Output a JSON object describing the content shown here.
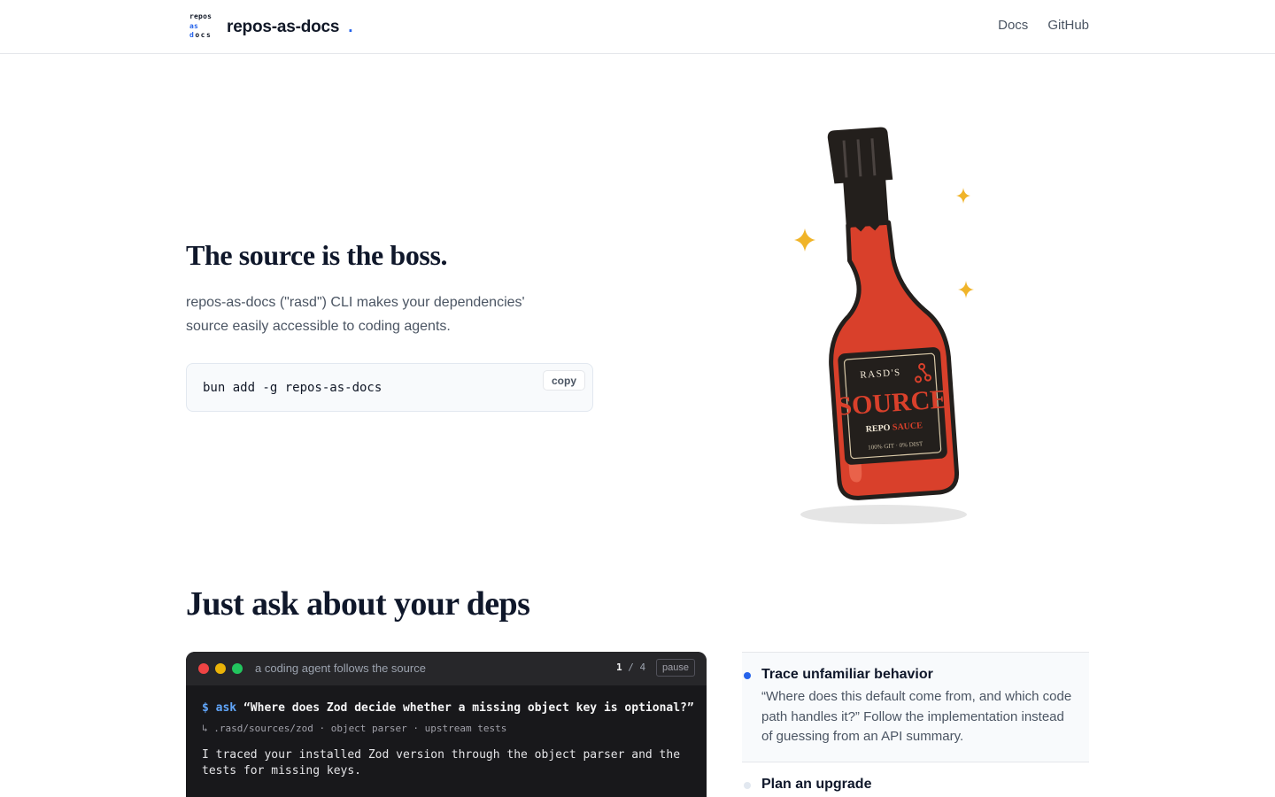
{
  "header": {
    "logo_lines": [
      {
        "accent": "r",
        "rest": "epos"
      },
      {
        "accent": "as",
        "rest": ""
      },
      {
        "accent": "d",
        "rest": "ocs"
      }
    ],
    "brand_name": "repos-as-docs",
    "brand_dot": ".",
    "nav": [
      {
        "label": "Docs"
      },
      {
        "label": "GitHub"
      }
    ]
  },
  "hero": {
    "title": "The source is the boss.",
    "description": "repos-as-docs (\"rasd\") CLI makes your dependencies' source easily accessible to coding agents.",
    "install_command": "bun add -g repos-as-docs",
    "copy_label": "copy"
  },
  "bottle_label": {
    "brand": "RASD'S",
    "name": "SOURCE",
    "tagline_a": "REPO",
    "tagline_b": "SAUCE",
    "fineprint": "100% GIT · 0% DIST",
    "colors": {
      "sauce": "#d9402b",
      "cap": "#231f1c",
      "sparkle": "#f0b429",
      "label_bg": "#231f1c",
      "cream": "#f3ead8"
    }
  },
  "section": {
    "title": "Just ask about your deps"
  },
  "terminal": {
    "title": "a coding agent follows the source",
    "counter_current": "1",
    "counter_rest": " / 4",
    "pause_label": "pause",
    "prompt_symbol": "$ ask",
    "question": "“Where does Zod decide whether a missing object key is optional?”",
    "sources": "↳ .rasd/sources/zod · object parser · upstream tests",
    "answer": "I traced your installed Zod version through the object parser and the tests for missing keys."
  },
  "features": [
    {
      "title": "Trace unfamiliar behavior",
      "description": "“Where does this default come from, and which code path handles it?” Follow the implementation instead of guessing from an API summary.",
      "active": true
    },
    {
      "title": "Plan an upgrade",
      "description": "",
      "active": false
    }
  ]
}
